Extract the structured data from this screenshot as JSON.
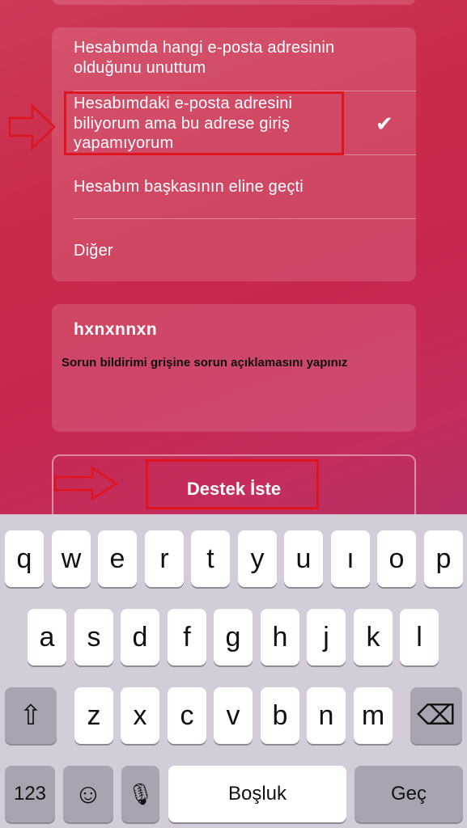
{
  "options": [
    {
      "label": "Hesabımda hangi e-posta adresinin olduğunu unuttum",
      "selected": false
    },
    {
      "label": "Hesabımdaki e-posta adresini biliyorum ama bu adrese giriş yapamıyorum",
      "selected": true
    },
    {
      "label": "Hesabım başkasının eline geçti",
      "selected": false
    },
    {
      "label": "Diğer",
      "selected": false
    }
  ],
  "check_symbol": "✔",
  "description": {
    "value": "hxnxnnxn",
    "annotation": "Sorun bildirimi grişine sorun açıklamasını yapınız"
  },
  "support_button": {
    "label": "Destek İste"
  },
  "keyboard": {
    "row1": [
      "q",
      "w",
      "e",
      "r",
      "t",
      "y",
      "u",
      "ı",
      "o",
      "p"
    ],
    "row2": [
      "a",
      "s",
      "d",
      "f",
      "g",
      "h",
      "j",
      "k",
      "l"
    ],
    "row3": [
      "z",
      "x",
      "c",
      "v",
      "b",
      "n",
      "m"
    ],
    "shift_symbol": "⇧",
    "backspace_symbol": "⌫",
    "numbers_label": "123",
    "emoji_symbol": "☺",
    "mic_symbol": "🎙",
    "space_label": "Boşluk",
    "return_label": "Geç"
  },
  "colors": {
    "annotation_red": "#e0141f",
    "background": "#c92a4a"
  }
}
